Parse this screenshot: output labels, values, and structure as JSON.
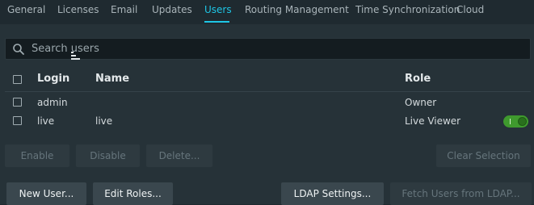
{
  "tabs": [
    {
      "label": "General"
    },
    {
      "label": "Licenses"
    },
    {
      "label": "Email"
    },
    {
      "label": "Updates"
    },
    {
      "label": "Users"
    },
    {
      "label": "Routing Management"
    },
    {
      "label": "Time Synchronization"
    },
    {
      "label": "Cloud"
    }
  ],
  "active_tab": "Users",
  "search": {
    "placeholder": "Search users",
    "value": ""
  },
  "table": {
    "columns": {
      "login": "Login",
      "name": "Name",
      "role": "Role"
    },
    "sort_column": "Login",
    "rows": [
      {
        "login": "admin",
        "name": "",
        "role": "Owner",
        "selected": false,
        "has_toggle": false
      },
      {
        "login": "live",
        "name": "live",
        "role": "Live Viewer",
        "selected": false,
        "has_toggle": true,
        "toggle_on": true
      }
    ]
  },
  "selection_actions": {
    "enable": "Enable",
    "disable": "Disable",
    "delete": "Delete...",
    "clear_selection": "Clear Selection"
  },
  "footer_actions": {
    "new_user": "New User...",
    "edit_roles": "Edit Roles...",
    "ldap_settings": "LDAP Settings...",
    "fetch_users": "Fetch Users from LDAP..."
  },
  "colors": {
    "accent": "#1ec6e6",
    "toggle_on": "#3f9a2e",
    "background": "#263238",
    "tabbar": "#1f2a30"
  }
}
